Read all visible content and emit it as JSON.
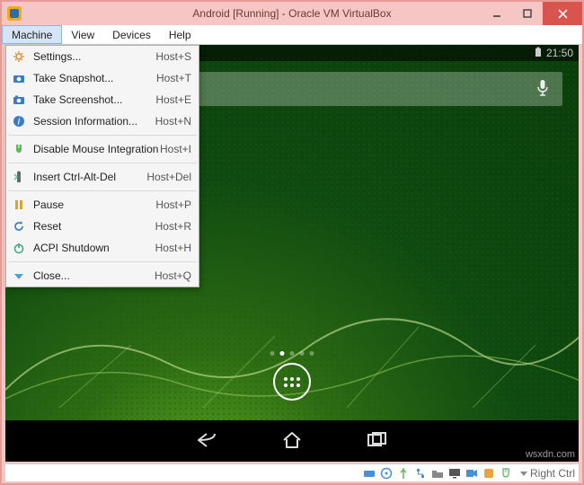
{
  "window": {
    "title": "Android [Running] - Oracle VM VirtualBox"
  },
  "menubar": {
    "items": [
      "Machine",
      "View",
      "Devices",
      "Help"
    ],
    "open_index": 0
  },
  "machine_menu": [
    {
      "icon": "gear",
      "label": "Settings...",
      "shortcut": "Host+S"
    },
    {
      "icon": "camera",
      "label": "Take Snapshot...",
      "shortcut": "Host+T"
    },
    {
      "icon": "camera2",
      "label": "Take Screenshot...",
      "shortcut": "Host+E"
    },
    {
      "icon": "info",
      "label": "Session Information...",
      "shortcut": "Host+N"
    },
    {
      "sep": true
    },
    {
      "icon": "mouse",
      "label": "Disable Mouse Integration",
      "shortcut": "Host+I"
    },
    {
      "sep": true
    },
    {
      "icon": "keyboard",
      "label": "Insert Ctrl-Alt-Del",
      "shortcut": "Host+Del"
    },
    {
      "sep": true
    },
    {
      "icon": "pause",
      "label": "Pause",
      "shortcut": "Host+P"
    },
    {
      "icon": "reset",
      "label": "Reset",
      "shortcut": "Host+R"
    },
    {
      "icon": "power",
      "label": "ACPI Shutdown",
      "shortcut": "Host+H"
    },
    {
      "sep": true
    },
    {
      "icon": "close",
      "label": "Close...",
      "shortcut": "Host+Q"
    }
  ],
  "android": {
    "clock": "21:50"
  },
  "statusbar": {
    "host_key": "Right Ctrl"
  },
  "watermark": "wsxdn.com"
}
